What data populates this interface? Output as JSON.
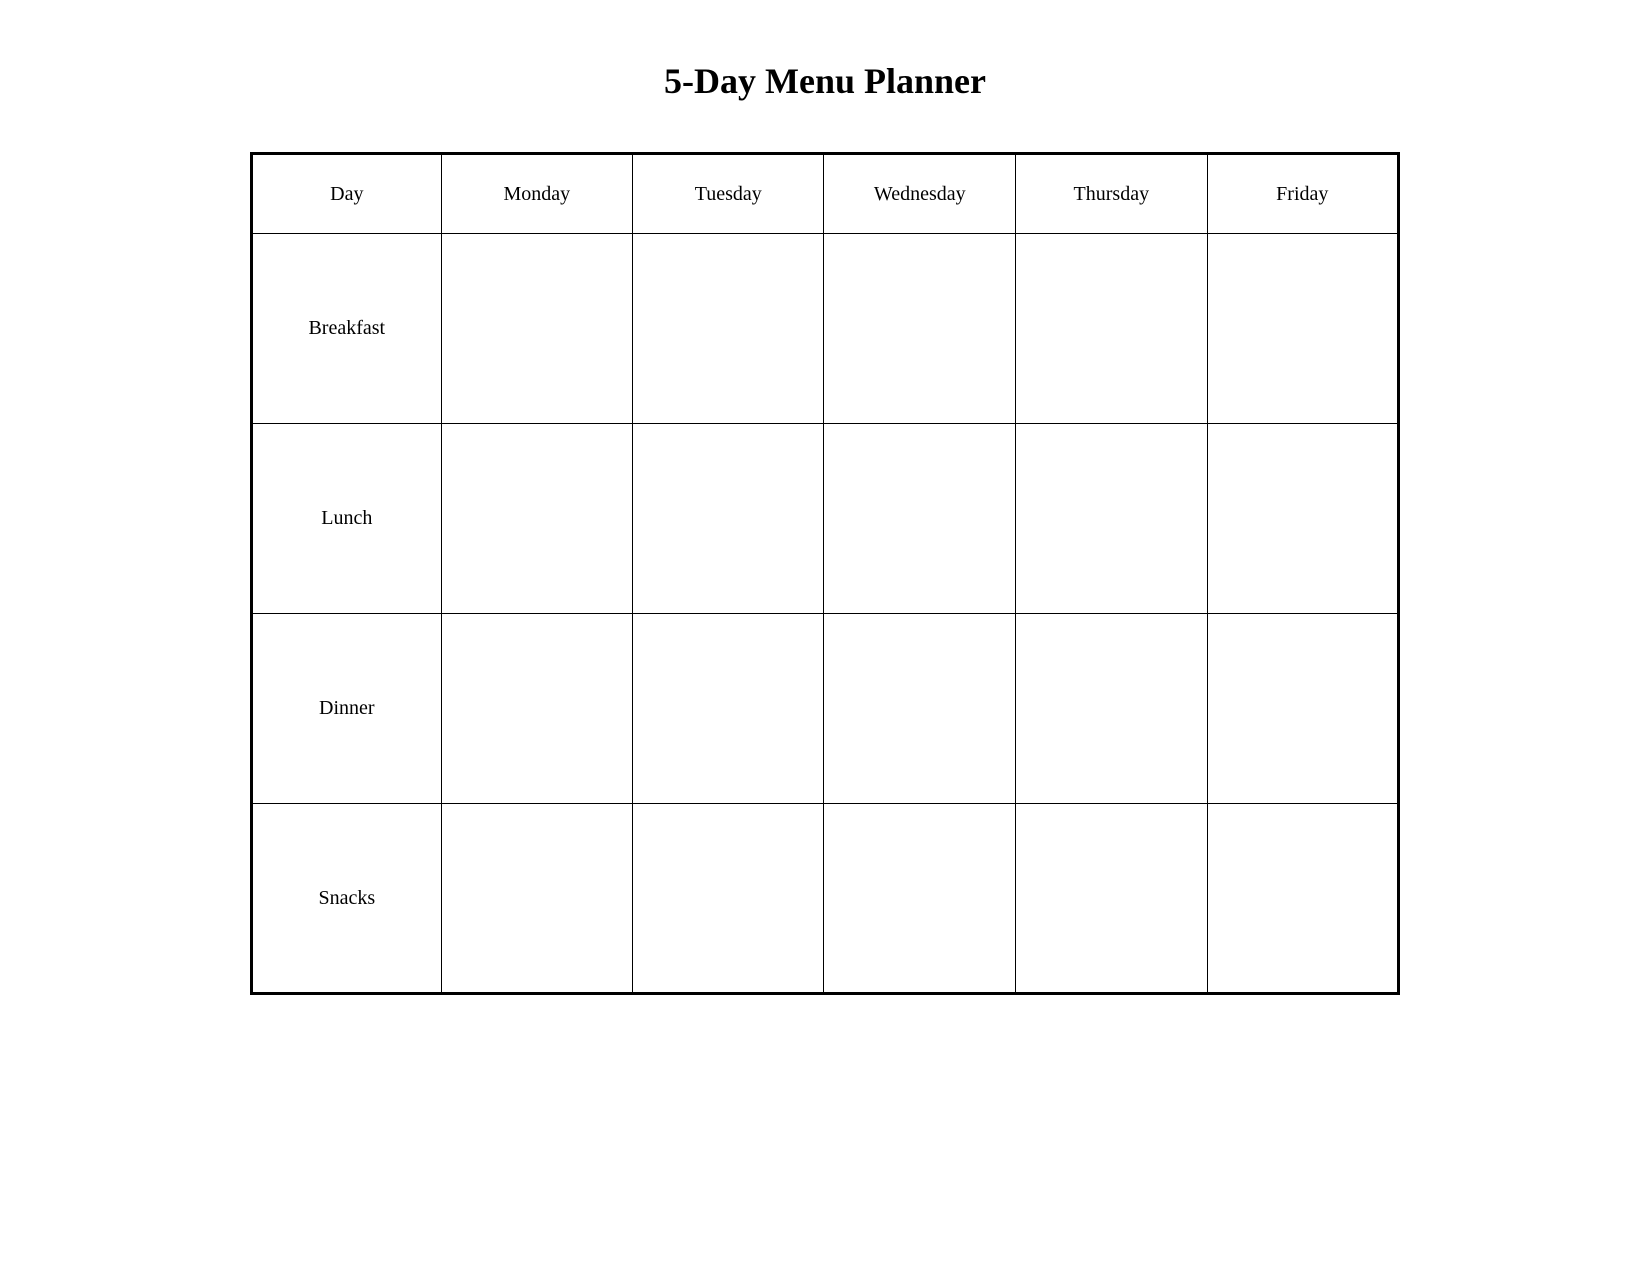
{
  "title": "5-Day Menu Planner",
  "table": {
    "headers": {
      "day": "Day",
      "col1": "Monday",
      "col2": "Tuesday",
      "col3": "Wednesday",
      "col4": "Thursday",
      "col5": "Friday"
    },
    "rows": [
      {
        "label": "Breakfast"
      },
      {
        "label": "Lunch"
      },
      {
        "label": "Dinner"
      },
      {
        "label": "Snacks"
      }
    ]
  }
}
